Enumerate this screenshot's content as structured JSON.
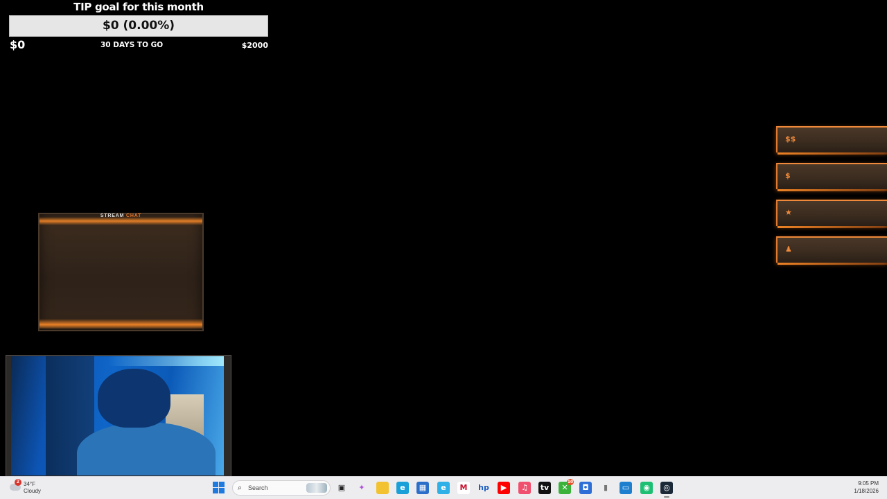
{
  "tip_goal": {
    "title": "TIP goal for this month",
    "progress_text": "$0 (0.00%)",
    "progress_fraction": 0,
    "current": "$0",
    "days_left": "30 DAYS TO GO",
    "target": "$2000",
    "fill_color": "#f06a1c"
  },
  "chat": {
    "label_main": "STREAM",
    "label_accent": "CHAT"
  },
  "side_panel": {
    "items": [
      {
        "icon": "$$",
        "icon_name": "double-dollar-icon"
      },
      {
        "icon": "$",
        "icon_name": "dollar-icon"
      },
      {
        "icon": "★",
        "icon_name": "star-icon"
      },
      {
        "icon": "♟",
        "icon_name": "person-icon"
      }
    ]
  },
  "taskbar": {
    "weather": {
      "badge": "2",
      "temp": "34°F",
      "condition": "Cloudy"
    },
    "search_placeholder": "Search",
    "apps": [
      {
        "name": "task-view",
        "glyph": "▣",
        "bg": "#ededf0",
        "fg": "#222"
      },
      {
        "name": "copilot",
        "glyph": "✦",
        "bg": "#ededf0",
        "fg": "#b04fd8"
      },
      {
        "name": "file-explorer",
        "glyph": "▰",
        "bg": "#f2c230",
        "fg": "#f2c230"
      },
      {
        "name": "edge",
        "glyph": "e",
        "bg": "#1aa0d8",
        "fg": "#ffffff"
      },
      {
        "name": "microsoft-store",
        "glyph": "▦",
        "bg": "#2b6fc9",
        "fg": "#ffffff"
      },
      {
        "name": "edge-alt",
        "glyph": "e",
        "bg": "#2fb0e6",
        "fg": "#ffffff"
      },
      {
        "name": "mcafee",
        "glyph": "M",
        "bg": "#ffffff",
        "fg": "#c8102e"
      },
      {
        "name": "hp",
        "glyph": "hp",
        "bg": "#ededf0",
        "fg": "#1b5bbf"
      },
      {
        "name": "youtube",
        "glyph": "▶",
        "bg": "#ff0000",
        "fg": "#ffffff"
      },
      {
        "name": "itunes",
        "glyph": "♫",
        "bg": "#f0506e",
        "fg": "#ffffff"
      },
      {
        "name": "apple-tv",
        "glyph": "tv",
        "bg": "#111111",
        "fg": "#ffffff"
      },
      {
        "name": "xbox",
        "glyph": "✕",
        "bg": "#3bb33b",
        "fg": "#ffffff",
        "badge": "10"
      },
      {
        "name": "notes",
        "glyph": "◘",
        "bg": "#2d6fd6",
        "fg": "#ffffff"
      },
      {
        "name": "mouse",
        "glyph": "▮",
        "bg": "#ededf0",
        "fg": "#777777"
      },
      {
        "name": "remote-desktop",
        "glyph": "▭",
        "bg": "#1e7fcf",
        "fg": "#ffffff"
      },
      {
        "name": "gamepad",
        "glyph": "◉",
        "bg": "#1dbf73",
        "fg": "#ffffff"
      },
      {
        "name": "steam",
        "glyph": "◎",
        "bg": "#1b2838",
        "fg": "#ffffff",
        "active": true
      }
    ],
    "clock": {
      "time": "9:05 PM",
      "date": "1/18/2026"
    }
  }
}
